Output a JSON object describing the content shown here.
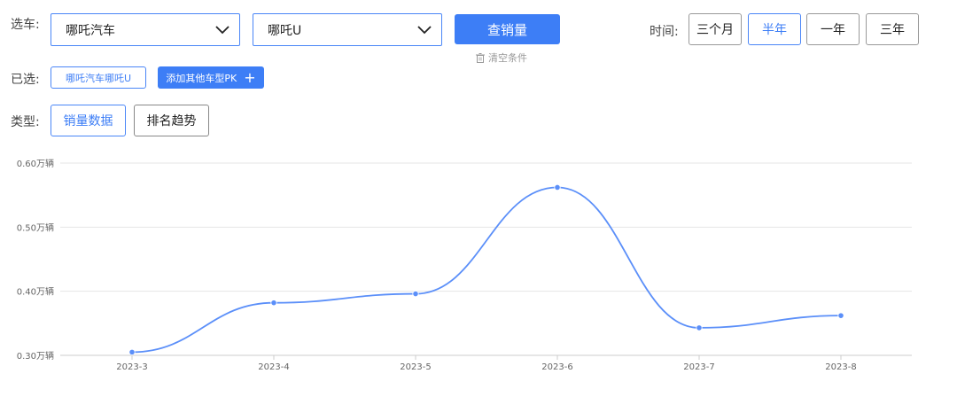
{
  "filters": {
    "select_car_label": "选车:",
    "brand_select": "哪吒汽车",
    "model_select": "哪吒U",
    "query_button": "查销量",
    "clear_text": "清空条件",
    "time_label": "时间:",
    "time_options": [
      "三个月",
      "半年",
      "一年",
      "三年"
    ],
    "time_selected": "半年"
  },
  "selected": {
    "label": "已选:",
    "chip": "哪吒汽车哪吒U",
    "add_pk_button": "添加其他车型PK",
    "add_icon": "plus-icon"
  },
  "type": {
    "label": "类型:",
    "options": [
      "销量数据",
      "排名趋势"
    ],
    "active": "销量数据"
  },
  "colors": {
    "accent": "#3d7ef6",
    "line": "#5b8ff9",
    "grid": "#e6e6e6"
  },
  "chart_data": {
    "type": "line",
    "categories": [
      "2023-3",
      "2023-4",
      "2023-5",
      "2023-6",
      "2023-7",
      "2023-8"
    ],
    "series": [
      {
        "values": [
          0.305,
          0.382,
          0.396,
          0.562,
          0.343,
          0.362
        ]
      }
    ],
    "y_ticks": [
      "0.60万辆",
      "0.50万辆",
      "0.40万辆",
      "0.30万辆"
    ],
    "ylim": [
      0.3,
      0.6
    ],
    "grid": true,
    "smooth": true
  }
}
